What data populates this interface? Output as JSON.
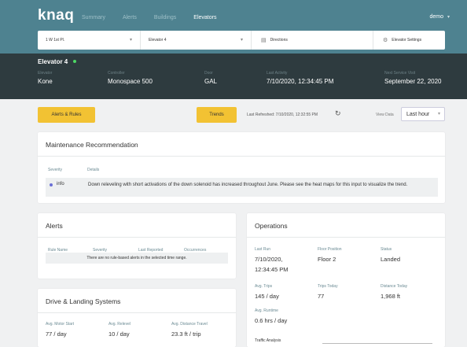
{
  "nav": {
    "logo": "knaq",
    "links": [
      "Summary",
      "Alerts",
      "Buildings",
      "Elevators"
    ],
    "user": "demo",
    "user_caret": "▾"
  },
  "selectors": {
    "building": "1 W 1st Pl.",
    "elevator": "Elevator 4",
    "directions": "Directions",
    "settings": "Elevator Settings",
    "caret": "▾",
    "directions_icon": "▤",
    "settings_icon": "⚙"
  },
  "info": {
    "title": "Elevator 4",
    "fields": [
      {
        "label": "Elevator",
        "value": "Kone"
      },
      {
        "label": "Controller",
        "value": "Monospace 500"
      },
      {
        "label": "Door",
        "value": "GAL"
      },
      {
        "label": "Last Activity",
        "value": "7/10/2020, 12:34:45 PM"
      },
      {
        "label": "Next Service Visit",
        "value": "September 22, 2020"
      }
    ]
  },
  "toolbar": {
    "alerts_rules": "Alerts & Rules",
    "trends": "Trends",
    "refreshed": "Last Refreshed: 7/10/2020, 12:32:55 PM",
    "refresh_icon": "↻",
    "view_data_label": "View Data",
    "view_data_value": "Last hour",
    "caret": "▾"
  },
  "maintenance": {
    "title": "Maintenance Recommendation",
    "col_severity": "Severity",
    "col_details": "Details",
    "severity": "info",
    "details": "Down releveling with short activations of the down solenoid has increased throughout June. Please see the heat maps for this input to visualize the trend."
  },
  "alerts": {
    "title": "Alerts",
    "headers": [
      "Rule Name",
      "Severity",
      "Last Reported",
      "Occurrences"
    ],
    "empty": "There are no rule-based alerts in the selected time range."
  },
  "drive": {
    "title": "Drive & Landing Systems",
    "items": [
      {
        "label": "Avg. Motor Start",
        "value": "77 / day"
      },
      {
        "label": "Avg. Relevel",
        "value": "10 / day"
      },
      {
        "label": "Avg. Distance Travel",
        "value": "23.3 ft / trip"
      }
    ]
  },
  "operations": {
    "title": "Operations",
    "last_run_label": "Last Run",
    "last_run_line1": "7/10/2020,",
    "last_run_line2": "12:34:45 PM",
    "floor_label": "Floor Position",
    "floor_value": "Floor 2",
    "status_label": "Status",
    "status_value": "Landed",
    "trips_label": "Avg. Trips",
    "trips_value": "145 / day",
    "trips_today_label": "Trips Today",
    "trips_today_value": "77",
    "distance_label": "Distance Today",
    "distance_value": "1,968 ft",
    "runtime_label": "Avg. Runtime",
    "runtime_value": "0.6 hrs / day",
    "traffic_label": "Traffic Analysis"
  },
  "colors": {
    "nav": "#4e8290",
    "band": "#2e3b3f",
    "accent": "#f2c233",
    "status_ok": "#4cd964",
    "info_dot": "#6b6fd6"
  }
}
